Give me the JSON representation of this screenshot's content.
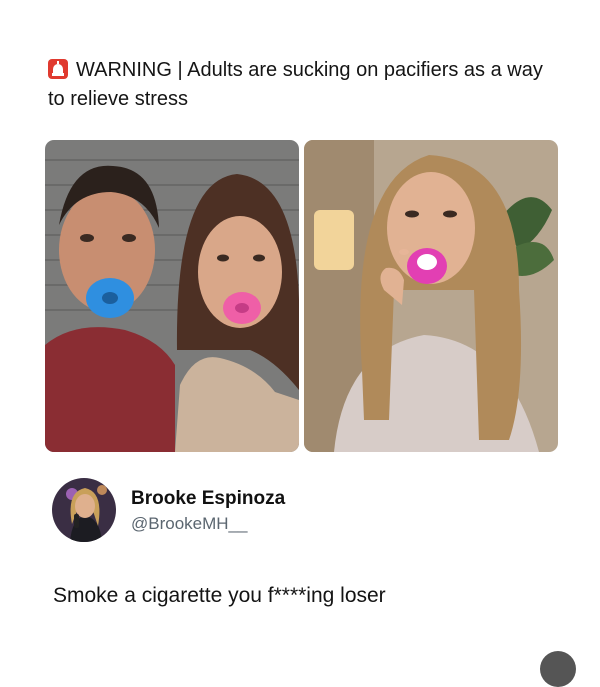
{
  "headline": {
    "icon": "siren-emoji-icon",
    "text": "WARNING | Adults are sucking on pacifiers as a way to relieve stress"
  },
  "images": [
    {
      "icon": "photo-man-woman-pacifiers",
      "pacifier_colors": [
        "#2f8fe0",
        "#ef5fa7"
      ]
    },
    {
      "icon": "photo-woman-pink-pacifier",
      "pacifier_colors": [
        "#e23fb3"
      ]
    }
  ],
  "post": {
    "author_name": "Brooke Espinoza",
    "author_handle": "@BrookeMH__",
    "text": "Smoke a cigarette you f****ing loser"
  },
  "colors": {
    "handle": "#5b6670",
    "accent_red": "#e03a2f"
  }
}
